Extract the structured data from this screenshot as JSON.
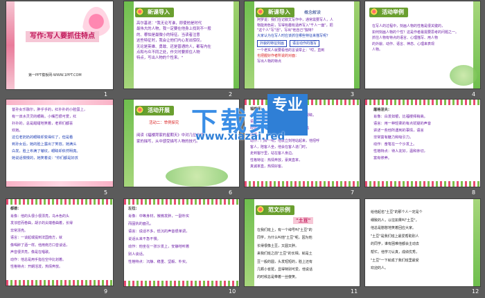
{
  "watermark": {
    "main": "下载集",
    "badge": "专业",
    "url": "www.xiazai.red"
  },
  "slides": [
    {
      "num": "1",
      "title": "写作:写人要抓住特点",
      "subtitle": "第一PPT模板网-WWW.1PPT.COM"
    },
    {
      "num": "2",
      "header": "新课导入",
      "lines": [
        "高尔基说：\"我无论写谁，即使他是时代",
        "最伟大的人物，我一定要在他身上找到不一般",
        "的、哪怕是最微小的特征。当读者注意",
        "这些特征时，我会让他们内心发出惊叹。",
        "无论是英雄、勇敢、还是普通的人，都有内在",
        "点和与众不同之处，作文时要抓住人物",
        "特点，写出人物的个性来。\""
      ]
    },
    {
      "num": "3",
      "header": "新课导入",
      "subheader": "概念解读",
      "lines": [
        "阿罗说：我们在记叙文写作中，通常需要写人，人",
        "物能用色彩，写得有趣有涵养写入\"千人一面\"，把",
        "\"这个人\"写\"活\"，写出\"他自己\"独特？",
        "大家认为在写人时应该抓住哪些特征来描写呢？"
      ],
      "boxes": [
        "外貌的特征刻画",
        "语言动作的描写"
      ],
      "tail": [
        "一个老实人就要看他的言谈举止：\"哎，直到",
        "也把握好作者所说的对面：",
        "写出人物的特点"
      ]
    },
    {
      "num": "4",
      "header": "活动举例",
      "lines": [
        "在写人的过程中，刻画人物的性格是很关键的，",
        "如何刻画人物的个性？这是作者最需要思考的问题之一。",
        "抓住人物有特点的语言、心理描写、用人物",
        "的外貌、动作、语言、神态、心理来表现",
        "人物。"
      ]
    },
    {
      "num": "5",
      "lines": [
        "昔孙女乐融尔，胖乎乎的，红扑扑的小脸蛋上，",
        "有一双水灵灵的眼睛。小嘴巴很可爱，红",
        "扑扑的，总是甜甜地笑着，老师们都喜",
        "欢她。",
        "",
        "这位老奶奶的眼睛却变得红了，但是看",
        "到孙女后，她的脸上露出了笑容。她满头",
        "白发，脸上布满了皱纹，眼睛却依然明亮。",
        "她说话慢慢的，她笑着说：\"你们都是好孩",
        "子。\""
      ]
    },
    {
      "num": "6",
      "header": "活动开展",
      "subheader": "活动二：举例探究",
      "lines": [
        "阅读《福楼拜家的星期天》中对几位大作",
        "家的描写，从中感受描写人物的技巧。"
      ]
    },
    {
      "num": "7",
      "subtitle": "福楼拜：",
      "lines": [
        "肖像：他有着大大的鼻子，蓝色的大眼睛，",
        "语言：他的声音洪亮雄厚，仿佛",
        "吹响一把军号，有时候也很低沉，神情",
        "活泼。",
        "动作：门铃一响，他就立刻地站起来，他招呼",
        "客人，陪客人坐，他会在客人进门时，",
        "走到客厅里，站在客人身边。",
        "性格特征：热情奔放，豪爽直率，",
        "真诚率直，热情好客。"
      ]
    },
    {
      "num": "8",
      "subtitle": "屠格涅夫：",
      "lines": [
        "肖像：白发如银，比福楼拜稍高。",
        "语言：用一种轻柔的有点犹疑的声音",
        "讲述一些他所遇到的事情，语言",
        "非常富有魅力和吸引力。",
        "动作：奋笔在一个沙发上。",
        "性格特点：待人友好，温和亲切，",
        "富有修养。"
      ]
    },
    {
      "num": "9",
      "subtitle": "都德：",
      "lines": [
        "肖像：他的头很小很漂亮，乌木色的头",
        "发浓密而卷曲，胡子的尖端卷曲着，长得",
        "非常漂亮。",
        "语言：一谈起或提到法国南方，就",
        "像喝醉了酒一样。他用南方口音谈话，",
        "声音很洪亮，像是在唱歌。",
        "动作：他总是用手指在空中比划着。",
        "性格特点：开朗活泼，热情奔放。"
      ]
    },
    {
      "num": "10",
      "subtitle": "左拉：",
      "lines": [
        "肖像：中等身材，微微发胖，一副朴实",
        "而固执的面孔。",
        "语言：说话不多，低沉的声音很单调，",
        "说话从来不急不慢。",
        "动作：他坐在一张沙发上，安静地听着",
        "别人谈话。",
        "性格特点：沉静、稳重、坚毅、朴实。"
      ]
    },
    {
      "num": "11",
      "header": "范文示例",
      "centerTitle": "\"土豆\"",
      "lines": [
        "在我们班上，有一个绰号叫\"土豆\"的",
        "同学，为什么叫他\"土豆\"呢，因为他",
        "长得很像土豆，又圆又胖。",
        "来我们班之前\"土豆\"的长相，就是土",
        "豆一般的圆，头发短短的，脸上还有",
        "几颗小雀斑，显得特别可爱。他说话",
        "的时候总是带着一丝傻笑。"
      ]
    },
    {
      "num": "12",
      "lines": [
        "给他起名\"土豆\"的那个人一定是个",
        "细致的人，以往如果叫\"土豆\"，",
        "他总是憨憨地笑着回应大家。",
        "\"土豆\"是我们班上最爱帮助别人",
        "的同学，谁有困难他都会主动去",
        "帮忙。他学习认真，成绩优秀，",
        "\"土豆\"一下就成了我们班里最受",
        "欢迎的人。"
      ]
    }
  ]
}
